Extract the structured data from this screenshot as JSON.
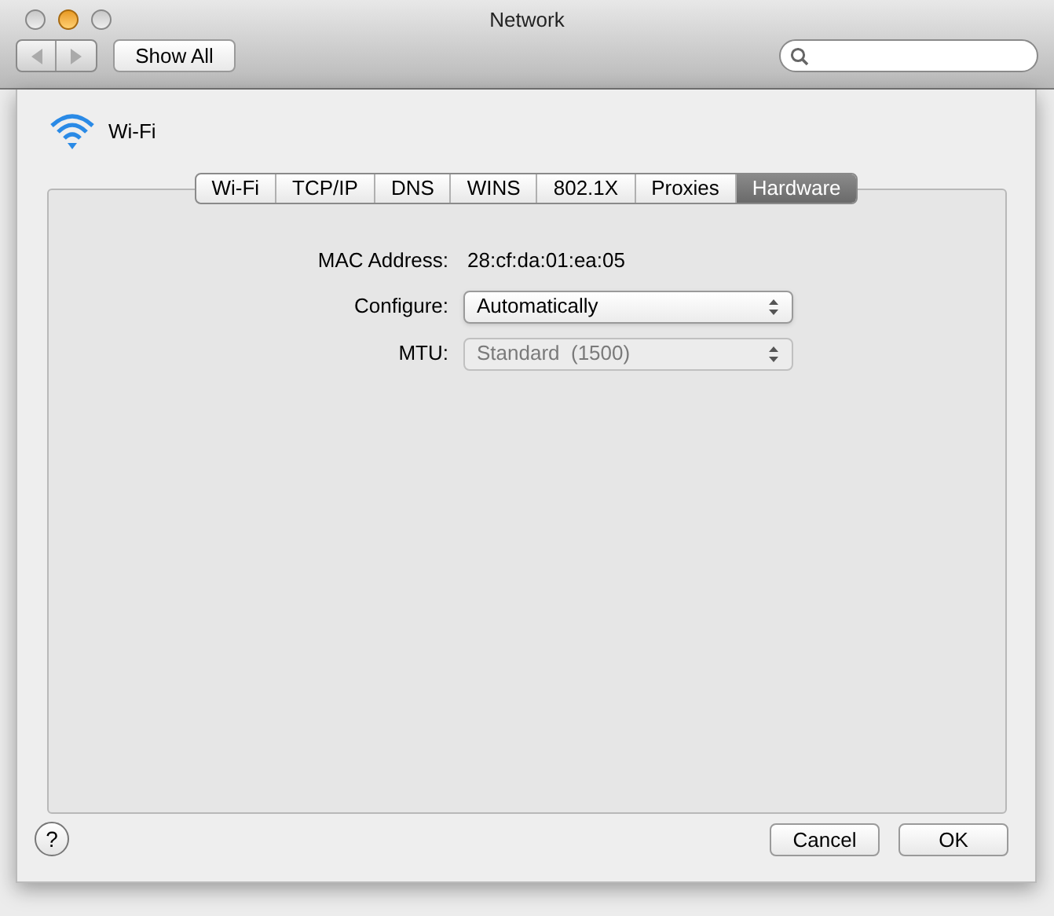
{
  "window": {
    "title": "Network"
  },
  "toolbar": {
    "show_all": "Show All"
  },
  "service": "Wi-Fi",
  "sheet": {
    "tabs": [
      {
        "label": "Wi-Fi",
        "selected": false
      },
      {
        "label": "TCP/IP",
        "selected": false
      },
      {
        "label": "DNS",
        "selected": false
      },
      {
        "label": "WINS",
        "selected": false
      },
      {
        "label": "802.1X",
        "selected": false
      },
      {
        "label": "Proxies",
        "selected": false
      },
      {
        "label": "Hardware",
        "selected": true
      }
    ],
    "mac_label": "MAC Address:",
    "mac_value": "28:cf:da:01:ea:05",
    "configure": {
      "label": "Configure:",
      "value": "Automatically",
      "disabled": false
    },
    "mtu": {
      "label": "MTU:",
      "value": "Standard  (1500)",
      "disabled": true
    },
    "help": "?",
    "cancel": "Cancel",
    "ok": "OK"
  }
}
